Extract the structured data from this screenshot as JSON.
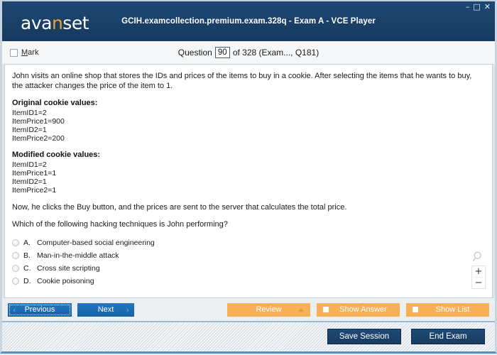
{
  "window": {
    "title": "GCIH.examcollection.premium.exam.328q - Exam A - VCE Player",
    "logo_main_1": "ava",
    "logo_accent": "n",
    "logo_main_2": "set",
    "minimize": "–",
    "maximize": "□",
    "close": "✕",
    "accent_color": "#f0a030",
    "header_color": "#1a4068"
  },
  "question_header": {
    "mark_label_accel": "M",
    "mark_label_rest": "ark",
    "question_word": "Question",
    "question_number": "90",
    "of_text": "of 328 (Exam..., Q181)"
  },
  "question": {
    "intro": "John visits an online shop that stores the IDs and prices of the items to buy in a cookie. After selecting the items that he wants to buy, the attacker changes the price of the item to 1.",
    "blocks": [
      {
        "title": "Original cookie values:",
        "lines": [
          "ItemID1=2",
          "ItemPrice1=900",
          "ItemID2=1",
          "ItemPrice2=200"
        ]
      },
      {
        "title": "Modified cookie values:",
        "lines": [
          "ItemID1=2",
          "ItemPrice1=1",
          "ItemID2=1",
          "ItemPrice2=1"
        ]
      }
    ],
    "after_text": "Now, he clicks the Buy button, and the prices are sent to the server that calculates the total price.",
    "prompt": "Which of the following hacking techniques is John performing?",
    "options": [
      {
        "letter": "A.",
        "text": "Computer-based social engineering",
        "selected": false
      },
      {
        "letter": "B.",
        "text": "Man-in-the-middle attack",
        "selected": false
      },
      {
        "letter": "C.",
        "text": "Cross site scripting",
        "selected": false
      },
      {
        "letter": "D.",
        "text": "Cookie poisoning",
        "selected": false
      }
    ]
  },
  "zoom_controls": {
    "magnifier": "magnifier-icon",
    "zoom_in": "+",
    "zoom_out": "−"
  },
  "action_bar": {
    "previous": "Previous",
    "previous_chevron": "‹",
    "next": "Next",
    "next_chevron": "›",
    "review": "Review",
    "show_answer": "Show Answer",
    "show_list": "Show List",
    "orange_color": "#f7b055",
    "blue_color": "#1463a8"
  },
  "footer": {
    "save_session": "Save Session",
    "end_exam": "End Exam"
  }
}
